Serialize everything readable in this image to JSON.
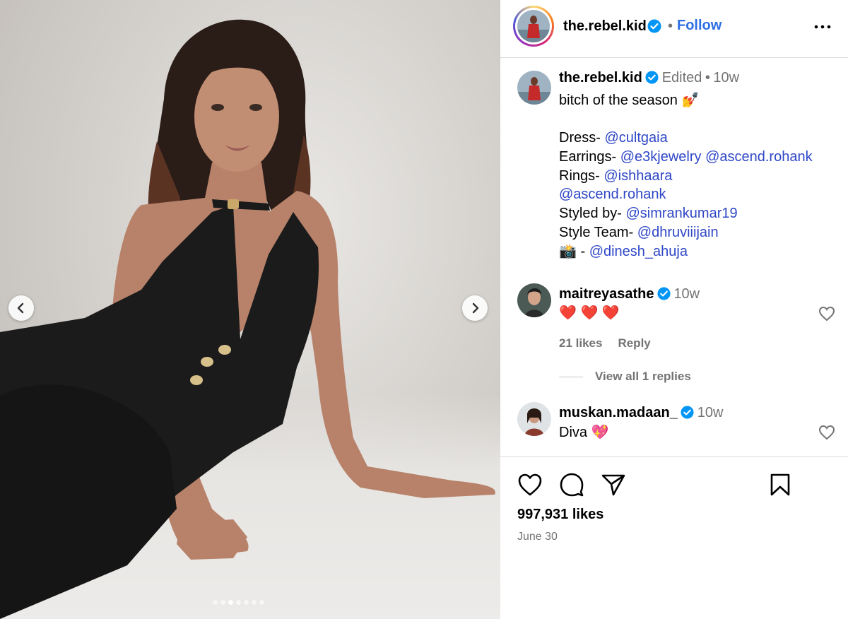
{
  "post": {
    "username": "the.rebel.kid",
    "separator": "•",
    "follow_label": "Follow",
    "more_icon": "more-options-icon"
  },
  "caption": {
    "username": "the.rebel.kid",
    "edited": "Edited",
    "dot": "•",
    "age": "10w",
    "lines": [
      {
        "prefix": "bitch of the season ",
        "emoji": "💅"
      },
      {
        "blank": true
      },
      {
        "prefix": "Dress- ",
        "mentions": [
          "@cultgaia"
        ]
      },
      {
        "prefix": "Earrings- ",
        "mentions": [
          "@e3kjewelry",
          "@ascend.rohank"
        ]
      },
      {
        "prefix": "Rings- ",
        "mentions": [
          "@ishhaara"
        ]
      },
      {
        "prefix": "",
        "mentions": [
          "@ascend.rohank"
        ]
      },
      {
        "prefix": "Styled by- ",
        "mentions": [
          "@simrankumar19"
        ]
      },
      {
        "prefix": "Style Team- ",
        "mentions": [
          "@dhruviiijain"
        ]
      },
      {
        "prefix": "📸 - ",
        "mentions": [
          "@dinesh_ahuja"
        ]
      }
    ]
  },
  "comments": [
    {
      "username": "maitreyasathe",
      "age": "10w",
      "text": "❤️ ❤️ ❤️",
      "likes": "21 likes",
      "reply": "Reply",
      "view_replies": "View all 1 replies"
    },
    {
      "username": "muskan.madaan_",
      "age": "10w",
      "text": "Diva 💖"
    }
  ],
  "footer": {
    "likes": "997,931 likes",
    "date": "June 30"
  },
  "carousel": {
    "count": 7,
    "active_index": 2
  },
  "colors": {
    "follow": "#0095f6",
    "mention": "#00376b",
    "verified": "#0095f6",
    "muted": "#737373"
  }
}
